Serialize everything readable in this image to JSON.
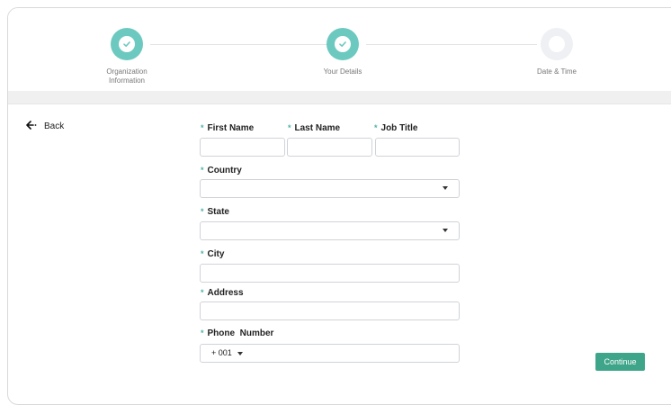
{
  "stepper": {
    "steps": [
      {
        "label_line1": "Organization",
        "label_line2": "Information",
        "status": "done"
      },
      {
        "label_line1": "Your Details",
        "label_line2": "",
        "status": "done"
      },
      {
        "label_line1": "Date & Time",
        "label_line2": "",
        "status": "todo"
      }
    ]
  },
  "nav": {
    "back_label": "Back"
  },
  "form": {
    "required_mark": "*",
    "first_name": {
      "label": "First Name",
      "value": ""
    },
    "last_name": {
      "label": "Last Name",
      "value": ""
    },
    "job_title": {
      "label": "Job Title",
      "value": ""
    },
    "country": {
      "label": "Country",
      "value": ""
    },
    "state": {
      "label": "State",
      "value": ""
    },
    "city": {
      "label": "City",
      "value": ""
    },
    "address": {
      "label": "Address",
      "value": ""
    },
    "phone": {
      "label": "Phone  Number",
      "code": "+ 001",
      "value": ""
    }
  },
  "actions": {
    "continue_label": "Continue"
  },
  "colors": {
    "accent": "#6cc9c0",
    "button": "#3fa58a",
    "required": "#4fb3a8"
  }
}
